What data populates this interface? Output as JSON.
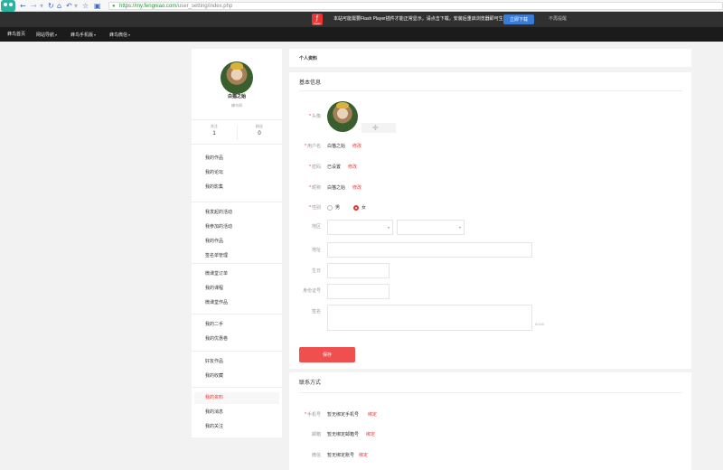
{
  "browser": {
    "url_host": "https://my.fengniao.com",
    "url_path": "/user_setting/index.php",
    "icons": [
      "back-icon",
      "forward-icon",
      "refresh-icon",
      "home-icon",
      "undo-icon",
      "star-icon",
      "tab-icon"
    ]
  },
  "flash_notice": {
    "logo_text": "flash",
    "message": "本站可能需要Flash Player插件才能正常显示，请点击下载，安装后重启浏览器即可生效！",
    "download_label": "立即下载",
    "dismiss_label": "不再提醒"
  },
  "site_nav": {
    "items": [
      {
        "label": "蜂鸟首页",
        "has_dropdown": false
      },
      {
        "label": "网站导航",
        "has_dropdown": true
      },
      {
        "label": "蜂鸟手机版",
        "has_dropdown": true
      },
      {
        "label": "蜂鸟微信",
        "has_dropdown": true
      }
    ]
  },
  "profile": {
    "name": "白猫之始",
    "subtitle": "蜂鸟网",
    "stats": [
      {
        "label": "关注",
        "value": "1"
      },
      {
        "label": "粉丝",
        "value": "0"
      }
    ],
    "menu_groups": [
      [
        "我的作品",
        "我的论坛",
        "我的影集"
      ],
      [
        "我发起的活动",
        "我参加的活动",
        "我的作品",
        "签名单管理"
      ],
      [
        "微课堂订单",
        "我的课程",
        "微课堂作品"
      ],
      [
        "我的二手",
        "我的优惠卷"
      ],
      [
        "好友作品",
        "我的收藏"
      ],
      [
        "我的资料",
        "我的消息",
        "我的关注"
      ]
    ],
    "active_item": "我的资料"
  },
  "profile_page": {
    "title": "个人资料",
    "basic_section": "基本信息",
    "save_label": "保存"
  },
  "basic_info": {
    "avatar_label": "头像",
    "username": {
      "label": "用户名",
      "value": "白猫之始",
      "action": "修改"
    },
    "password": {
      "label": "密码",
      "value": "已设置",
      "action": "修改"
    },
    "nickname": {
      "label": "昵称",
      "value": "白猫之始",
      "action": "修改"
    },
    "gender": {
      "label": "性别",
      "options": [
        "男",
        "女"
      ],
      "selected": "女"
    },
    "region": {
      "label": "地区"
    },
    "address": {
      "label": "地址"
    },
    "birthday": {
      "label": "生日"
    },
    "id_number": {
      "label": "身份证号"
    },
    "signature": {
      "label": "签名",
      "counter": "0/140"
    }
  },
  "contact": {
    "title": "联系方式",
    "phone": {
      "label": "手机号",
      "value": "暂无绑定手机号",
      "action": "绑定"
    },
    "email": {
      "label": "邮箱",
      "value": "暂无绑定邮箱号",
      "action": "绑定"
    },
    "wechat": {
      "label": "微信",
      "value": "暂无绑定账号",
      "action": "绑定"
    }
  }
}
